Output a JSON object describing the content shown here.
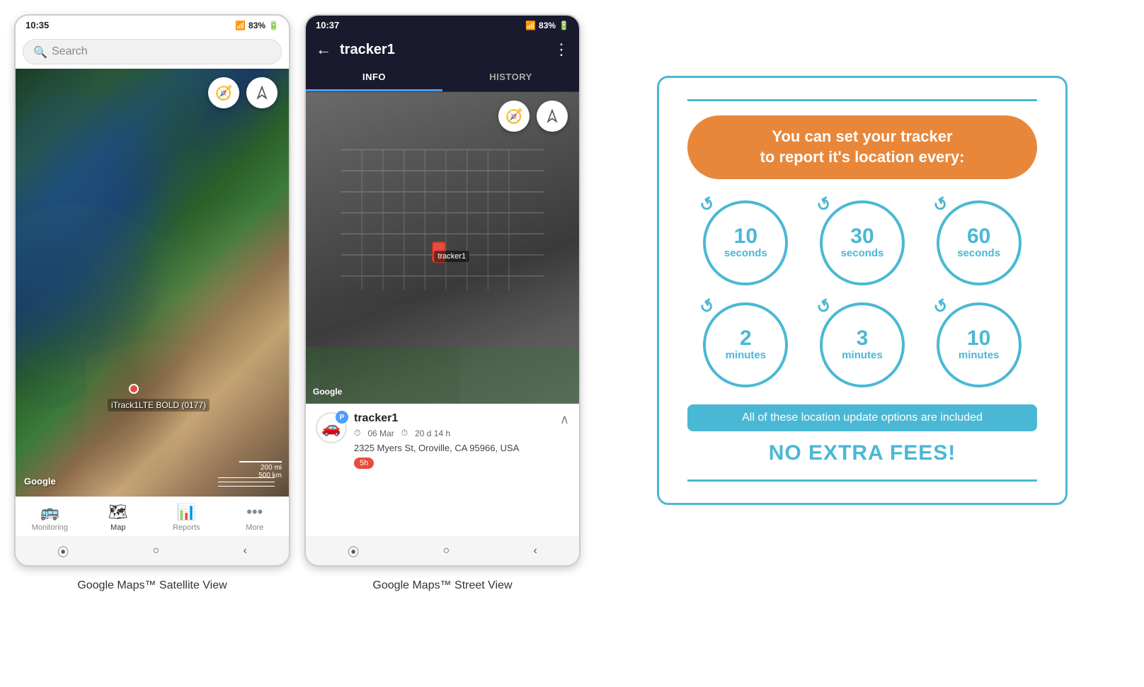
{
  "phone1": {
    "status_time": "10:35",
    "status_signal": "▲▲▲",
    "status_battery": "83%",
    "search_placeholder": "Search",
    "nav_items": [
      {
        "label": "Monitoring",
        "icon": "🚌",
        "active": false
      },
      {
        "label": "Map",
        "icon": "🗺",
        "active": true
      },
      {
        "label": "Reports",
        "icon": "📊",
        "active": false
      },
      {
        "label": "More",
        "icon": "•••",
        "active": false
      }
    ],
    "tracker_label": "iTrack1LTE BOLD (0177)",
    "google_label": "Google",
    "scale_200mi": "200 mi",
    "scale_500km": "500 km",
    "caption": "Google Maps™ Satellite View"
  },
  "phone2": {
    "status_time": "10:37",
    "status_signal": "▲▲▲",
    "status_battery": "83%",
    "header_title": "tracker1",
    "tab_info": "INFO",
    "tab_history": "HISTORY",
    "google_label": "Google",
    "tracker_name": "tracker1",
    "tracker_date": "06 Mar",
    "tracker_duration": "20 d 14 h",
    "tracker_address": "2325 Myers St, Oroville, CA 95966, USA",
    "tracker_badge": "5h",
    "tracker_label_map": "tracker1",
    "caption": "Google Maps™ Street View"
  },
  "infographic": {
    "title_line1": "You can set your tracker",
    "title_line2": "to report it's location every:",
    "divider_color": "#4ab8d4",
    "badge_color": "#e8873a",
    "circles": [
      {
        "number": "10",
        "unit": "seconds"
      },
      {
        "number": "30",
        "unit": "seconds"
      },
      {
        "number": "60",
        "unit": "seconds"
      },
      {
        "number": "2",
        "unit": "minutes"
      },
      {
        "number": "3",
        "unit": "minutes"
      },
      {
        "number": "10",
        "unit": "minutes"
      }
    ],
    "included_text": "All of these location update options are included",
    "no_extra_fees": "NO EXTRA FEES!"
  }
}
